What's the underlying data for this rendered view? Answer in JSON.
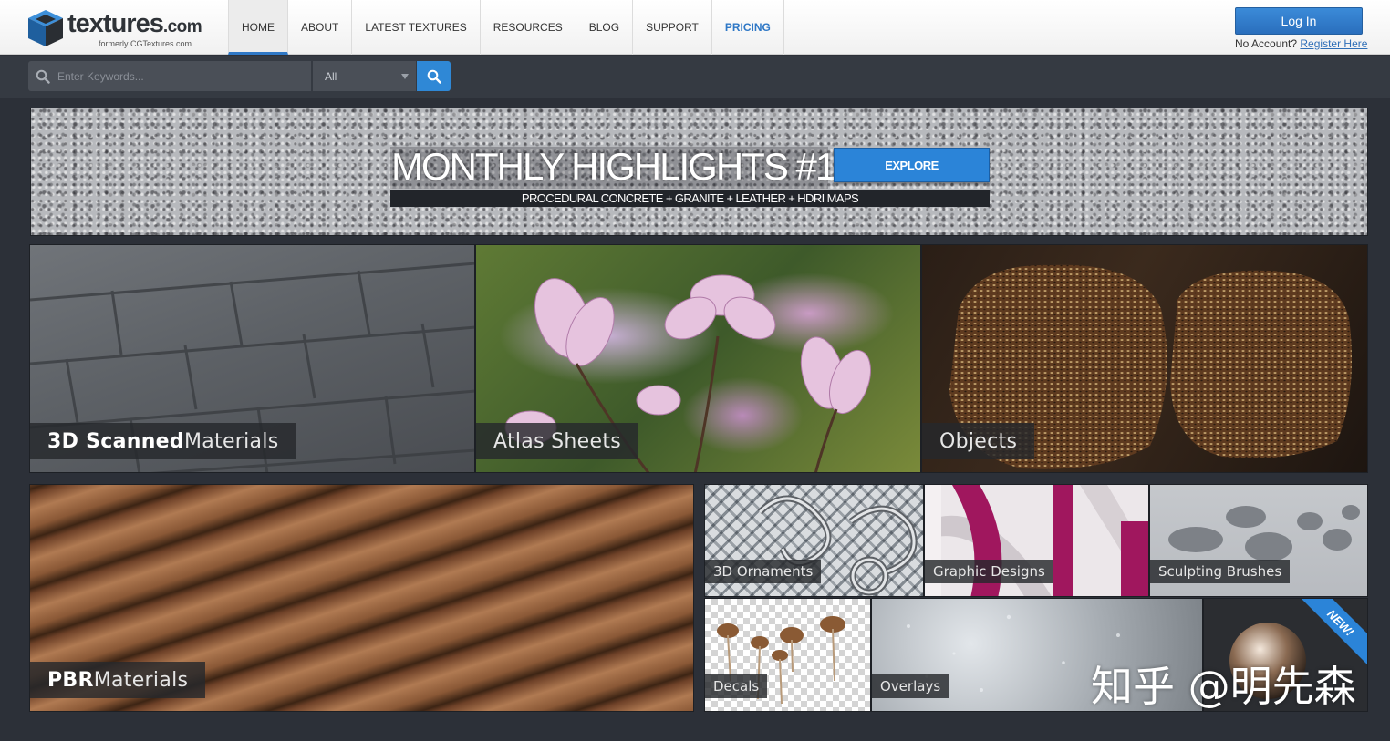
{
  "brand": {
    "name": "textures",
    "tld": ".com",
    "tagline": "formerly CGTextures.com"
  },
  "nav": {
    "items": [
      {
        "label": "HOME"
      },
      {
        "label": "ABOUT"
      },
      {
        "label": "LATEST TEXTURES"
      },
      {
        "label": "RESOURCES"
      },
      {
        "label": "BLOG"
      },
      {
        "label": "SUPPORT"
      },
      {
        "label": "PRICING"
      }
    ]
  },
  "account": {
    "login_label": "Log In",
    "no_account_text": "No Account?",
    "register_label": "Register Here"
  },
  "search": {
    "placeholder": "Enter Keywords...",
    "value": "",
    "category": "All"
  },
  "banner": {
    "title": "MONTHLY HIGHLIGHTS #15",
    "button": "EXPLORE",
    "subtitle": "PROCEDURAL CONCRETE + GRANITE + LEATHER + HDRI MAPS"
  },
  "tiles": {
    "scanned": {
      "bold": "3D Scanned",
      "rest": " Materials"
    },
    "atlas": "Atlas Sheets",
    "objects": "Objects",
    "pbr": {
      "bold": "PBR",
      "rest": " Materials"
    },
    "ornaments": "3D Ornaments",
    "graphic": "Graphic Designs",
    "sculpting": "Sculpting Brushes",
    "decals": "Decals",
    "overlays": "Overlays",
    "new_badge": "NEW!"
  },
  "watermark": "知乎 @明先森",
  "colors": {
    "accent": "#2f78c6",
    "header_bg": "#ffffff",
    "page_bg": "#2c3038",
    "search_bar_bg": "#353a42"
  }
}
